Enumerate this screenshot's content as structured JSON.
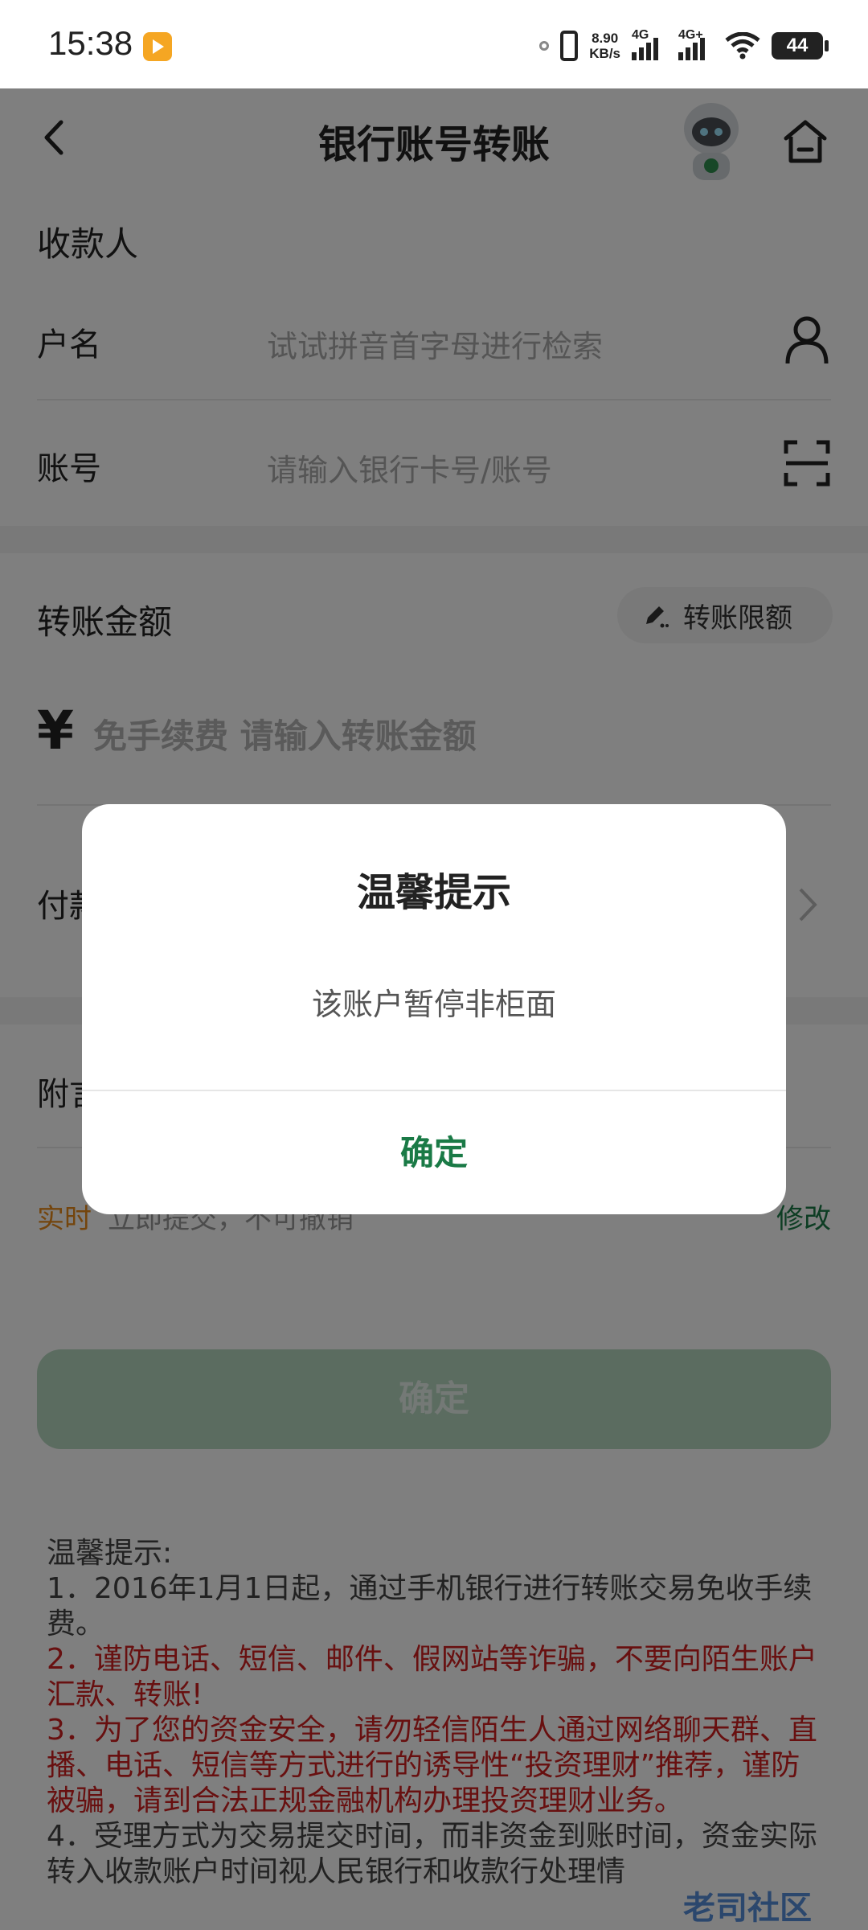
{
  "status_bar": {
    "time": "15:38",
    "speed_value": "8.90",
    "speed_unit": "KB/s",
    "sim1": "4G",
    "sim2": "4G+",
    "battery": "44"
  },
  "header": {
    "title": "银行账号转账",
    "back_icon": "back-arrow-icon",
    "home_icon": "home-icon",
    "assistant_icon": "robot-assistant-icon"
  },
  "payee": {
    "section_label": "收款人",
    "name_label": "户名",
    "name_placeholder": "试试拼音首字母进行检索",
    "account_label": "账号",
    "account_placeholder": "请输入银行卡号/账号"
  },
  "amount": {
    "label": "转账金额",
    "limit_button": "转账限额",
    "currency": "¥",
    "placeholder": "免手续费 请输入转账金额"
  },
  "payment": {
    "label_visible": "付款"
  },
  "remark": {
    "label_visible": "附言"
  },
  "timing": {
    "mode": "实时",
    "description": "立即提交，不可撤销",
    "modify": "修改"
  },
  "submit_button": "确定",
  "tips": {
    "heading": "温馨提示:",
    "items": [
      "1．2016年1月1日起，通过手机银行进行转账交易免收手续费。",
      "2．谨防电话、短信、邮件、假网站等诈骗，不要向陌生账户汇款、转账!",
      "3．为了您的资金安全，请勿轻信陌生人通过网络聊天群、直播、电话、短信等方式进行的诱导性“投资理财”推荐，谨防被骗，请到合法正规金融机构办理投资理财业务。",
      "4．受理方式为交易提交时间，而非资金到账时间，资金实际转入收款账户时间视人民银行和收款行处理情"
    ]
  },
  "dialog": {
    "title": "温馨提示",
    "message": "该账户暂停非柜面",
    "confirm": "确定"
  },
  "watermark": "老司社区",
  "colors": {
    "brand_green": "#1a7a46",
    "warning_red": "#d02020",
    "realtime_orange": "#e88a1a",
    "disabled_button": "#b7d8c1"
  }
}
